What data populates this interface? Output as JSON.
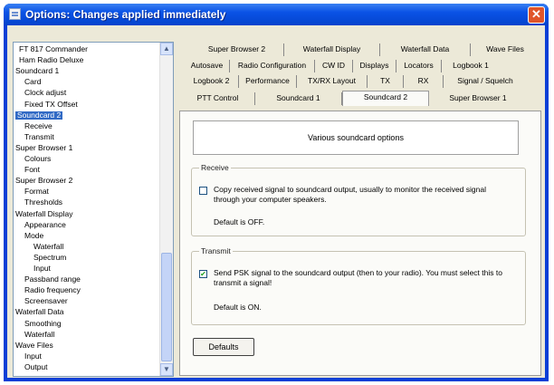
{
  "window": {
    "title": "Options: Changes applied immediately",
    "close_glyph": "✕"
  },
  "tree": {
    "items": [
      "FT 817 Commander",
      "Ham Radio Deluxe",
      "Soundcard 1",
      "Card",
      "Clock adjust",
      "Fixed TX Offset",
      "Soundcard 2",
      "Receive",
      "Transmit",
      "Super Browser 1",
      "Colours",
      "Font",
      "Super Browser 2",
      "Format",
      "Thresholds",
      "Waterfall Display",
      "Appearance",
      "Mode",
      "Waterfall",
      "Spectrum",
      "Input",
      "Passband range",
      "Radio frequency",
      "Screensaver",
      "Waterfall Data",
      "Smoothing",
      "Waterfall",
      "Wave Files",
      "Input",
      "Output"
    ],
    "selected": "Soundcard 2",
    "scroll_up_glyph": "▲",
    "scroll_down_glyph": "▼"
  },
  "tabs": {
    "row1": [
      "Super Browser 2",
      "Waterfall Display",
      "Waterfall Data",
      "Wave Files"
    ],
    "row2": [
      "Autosave",
      "Radio Configuration",
      "CW ID",
      "Displays",
      "Locators",
      "Logbook 1"
    ],
    "row3": [
      "Logbook 2",
      "Performance",
      "TX/RX Layout",
      "TX",
      "RX",
      "Signal / Squelch"
    ],
    "row4": [
      "PTT Control",
      "Soundcard 1",
      "Soundcard 2",
      "Super Browser 1"
    ],
    "active": "Soundcard 2"
  },
  "panel": {
    "header": "Various soundcard options",
    "receive": {
      "label": "Receive",
      "checkbox_text": "Copy received signal to soundcard output, usually to monitor the received signal through your computer speakers.",
      "checked": false,
      "default_text": "Default is OFF."
    },
    "transmit": {
      "label": "Transmit",
      "checkbox_text": "Send PSK signal to the soundcard output (then to your radio). You must select this to transmit a signal!",
      "checked": true,
      "check_glyph": "✔",
      "default_text": "Default is ON."
    },
    "defaults_button": "Defaults"
  }
}
